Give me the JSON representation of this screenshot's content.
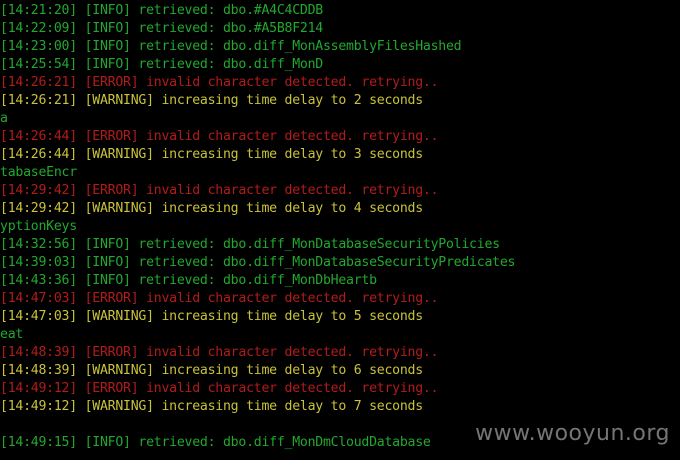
{
  "terminal": {
    "lines": [
      {
        "text": "[14:21:20] [INFO] retrieved: dbo.#A4C4CDDB",
        "level": "info"
      },
      {
        "text": "[14:22:09] [INFO] retrieved: dbo.#A5B8F214",
        "level": "info"
      },
      {
        "text": "[14:23:00] [INFO] retrieved: dbo.diff_MonAssemblyFilesHashed",
        "level": "info"
      },
      {
        "text": "[14:25:54] [INFO] retrieved: dbo.diff_MonD",
        "level": "info"
      },
      {
        "text": "[14:26:21] [ERROR] invalid character detected. retrying..",
        "level": "error"
      },
      {
        "text": "[14:26:21] [WARNING] increasing time delay to 2 seconds",
        "level": "warning"
      },
      {
        "text": "a",
        "level": "plain"
      },
      {
        "text": "[14:26:44] [ERROR] invalid character detected. retrying..",
        "level": "error"
      },
      {
        "text": "[14:26:44] [WARNING] increasing time delay to 3 seconds",
        "level": "warning"
      },
      {
        "text": "tabaseEncr",
        "level": "plain"
      },
      {
        "text": "[14:29:42] [ERROR] invalid character detected. retrying..",
        "level": "error"
      },
      {
        "text": "[14:29:42] [WARNING] increasing time delay to 4 seconds",
        "level": "warning"
      },
      {
        "text": "yptionKeys",
        "level": "plain"
      },
      {
        "text": "[14:32:56] [INFO] retrieved: dbo.diff_MonDatabaseSecurityPolicies",
        "level": "info"
      },
      {
        "text": "[14:39:03] [INFO] retrieved: dbo.diff_MonDatabaseSecurityPredicates",
        "level": "info"
      },
      {
        "text": "[14:43:36] [INFO] retrieved: dbo.diff_MonDbHeartb",
        "level": "info"
      },
      {
        "text": "[14:47:03] [ERROR] invalid character detected. retrying..",
        "level": "error"
      },
      {
        "text": "[14:47:03] [WARNING] increasing time delay to 5 seconds",
        "level": "warning"
      },
      {
        "text": "eat",
        "level": "plain"
      },
      {
        "text": "[14:48:39] [ERROR] invalid character detected. retrying..",
        "level": "error"
      },
      {
        "text": "[14:48:39] [WARNING] increasing time delay to 6 seconds",
        "level": "warning"
      },
      {
        "text": "[14:49:12] [ERROR] invalid character detected. retrying..",
        "level": "error"
      },
      {
        "text": "[14:49:12] [WARNING] increasing time delay to 7 seconds",
        "level": "warning"
      },
      {
        "text": "",
        "level": "gap"
      },
      {
        "text": "[14:49:15] [INFO] retrieved: dbo.diff_MonDmCloudDatabase",
        "level": "info"
      }
    ]
  },
  "watermark": "www.wooyun.org",
  "colors": {
    "background": "#000000",
    "info": "#22a82e",
    "error": "#b21b1b",
    "warning": "#c9c23a"
  }
}
